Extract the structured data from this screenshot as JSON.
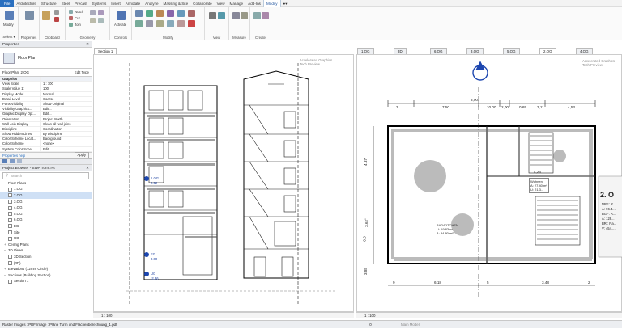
{
  "menu": [
    "File",
    "Architecture",
    "Structure",
    "Steel",
    "Precast",
    "Systems",
    "Insert",
    "Annotate",
    "Analyze",
    "Massing & Site",
    "Collaborate",
    "View",
    "Manage",
    "Add-Ins",
    "Modify",
    "●▾"
  ],
  "ribbon": {
    "select": "Select",
    "select_dropdown": "Select ▾",
    "modify": "Modify",
    "properties": "Properties",
    "clipboard": "Clipboard",
    "geometry": "Geometry",
    "controls": "Controls",
    "modify_group": "Modify",
    "view": "View",
    "measure": "Measure",
    "create": "Create",
    "notch": "Notch",
    "cut": "Cut",
    "join": "Join",
    "paste": "Paste",
    "activate": "Activate"
  },
  "properties": {
    "title": "Properties",
    "type_name": "Floor Plan",
    "selector_value": "Floor Plan: 2.OG",
    "edit_type": "Edit Type",
    "rows": [
      {
        "k": "Graphics",
        "v": "",
        "sec": true
      },
      {
        "k": "View Scale",
        "v": "1 : 100"
      },
      {
        "k": "Scale Value 1:",
        "v": "100"
      },
      {
        "k": "Display Model",
        "v": "Normal"
      },
      {
        "k": "Detail Level",
        "v": "Coarse"
      },
      {
        "k": "Parts Visibility",
        "v": "Show Original"
      },
      {
        "k": "Visibility/Graphics...",
        "v": "Edit..."
      },
      {
        "k": "Graphic Display Opt...",
        "v": "Edit..."
      },
      {
        "k": "Orientation",
        "v": "Project North"
      },
      {
        "k": "Wall Join Display",
        "v": "Clean all wall joins"
      },
      {
        "k": "Discipline",
        "v": "Coordination"
      },
      {
        "k": "Show Hidden Lines",
        "v": "By Discipline"
      },
      {
        "k": "Color Scheme Locat...",
        "v": "Background"
      },
      {
        "k": "Color Scheme",
        "v": "<none>"
      },
      {
        "k": "System Color Sche...",
        "v": "Edit..."
      }
    ],
    "help": "Properties help",
    "apply": "Apply"
  },
  "browser": {
    "title": "Project Browser - SWA Turm.rvt",
    "search_placeholder": "Search",
    "items": [
      {
        "label": "Floor Plans",
        "indent": 1,
        "exp": "–"
      },
      {
        "label": "1.OG",
        "indent": 2,
        "chk": true
      },
      {
        "label": "2.OG",
        "indent": 2,
        "chk": true,
        "sel": true
      },
      {
        "label": "3.OG",
        "indent": 2,
        "chk": true
      },
      {
        "label": "4.OG",
        "indent": 2,
        "chk": true
      },
      {
        "label": "5.OG",
        "indent": 2,
        "chk": true
      },
      {
        "label": "6.OG",
        "indent": 2,
        "chk": true
      },
      {
        "label": "EG",
        "indent": 2,
        "chk": true
      },
      {
        "label": "Site",
        "indent": 2,
        "chk": true
      },
      {
        "label": "UG",
        "indent": 2,
        "chk": true
      },
      {
        "label": "Ceiling Plans",
        "indent": 1,
        "exp": "+"
      },
      {
        "label": "3D Views",
        "indent": 1,
        "exp": "–"
      },
      {
        "label": "3D Section",
        "indent": 2,
        "chk": true
      },
      {
        "label": "{3D}",
        "indent": 2,
        "chk": true
      },
      {
        "label": "Elevations (12mm Circle)",
        "indent": 1,
        "exp": "+"
      },
      {
        "label": "Sections (Building Section)",
        "indent": 1,
        "exp": "–"
      },
      {
        "label": "Section 1",
        "indent": 2,
        "chk": true
      }
    ]
  },
  "tabs_left": [
    {
      "label": "Section 1",
      "active": true
    }
  ],
  "tabs_right": [
    {
      "label": "1.OG",
      "active": false
    },
    {
      "label": "3D",
      "active": false
    },
    {
      "label": "6.OG",
      "active": false
    },
    {
      "label": "3.OG",
      "active": false
    },
    {
      "label": "5.OG",
      "active": false
    },
    {
      "label": "2.OG",
      "active": true
    },
    {
      "label": "4.OG",
      "active": false
    }
  ],
  "graphics_badge": "Accelerated Graphics\nTech Preview",
  "section": {
    "levels": [
      {
        "name": "1.OG",
        "value": "2.92"
      },
      {
        "name": "EG",
        "value": "0.00"
      },
      {
        "name": "UG",
        "value": "-2.36"
      }
    ],
    "scale": "1 : 100"
  },
  "plan": {
    "dims_top": [
      "3",
      "7.50",
      "10.00",
      "2,00",
      "0,65",
      "3,11",
      "4,53"
    ],
    "dim_top_label": "3,00",
    "dims_bottom": [
      "9",
      "6.18",
      "5",
      "3.48",
      "2"
    ],
    "dims_left": [
      "4.37",
      "3.62°",
      "0.5",
      "3,85"
    ],
    "room_label": "2. O",
    "room_info": [
      "NRF: R...",
      "A: 96.4...",
      "BGF: R...",
      "A: 128...",
      "BRI: Ra...",
      "V: 454...."
    ],
    "tag_a": [
      "Wohnen",
      "A: 27.40 m²",
      "U: 21.3..."
    ],
    "tag_b": [
      "BAD/KITCHEN",
      "U: 19.83 m",
      "A: 34.80 m²"
    ],
    "scale": "1 : 100",
    "dim_mid": "4,26"
  },
  "status_bar": "Raster Images : PDF Image : Pläne Turm und Flachenberechnung_1.pdf",
  "status_main_model": "Main Model",
  "status_zero": ":0",
  "colors": {
    "accent": "#2a6fbf",
    "level": "#1d47b0"
  }
}
